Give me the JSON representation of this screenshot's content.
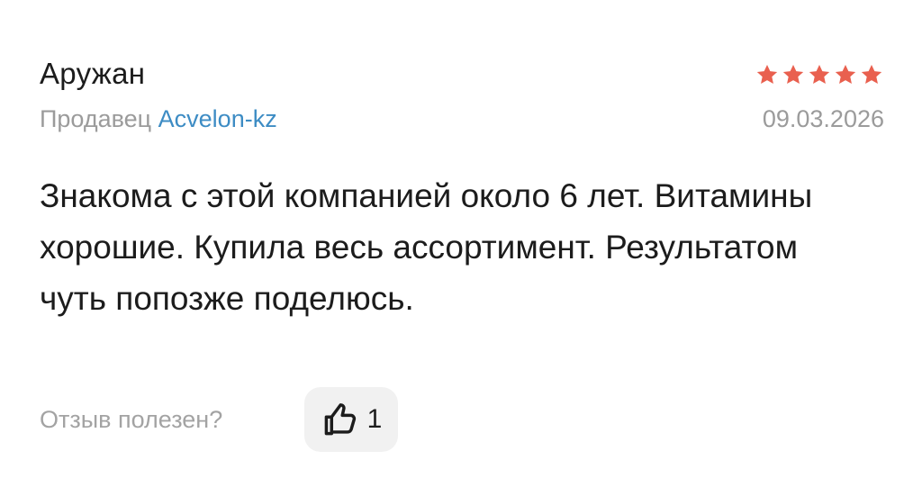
{
  "review": {
    "author": "Аружан",
    "rating": 5,
    "rating_max": 5,
    "star_color": "#e9604f",
    "seller_prefix": "Продавец",
    "seller_name": "Acvelon-kz",
    "seller_color": "#3d8cc4",
    "date": "09.03.2026",
    "text": "Знакома с этой компанией около 6 лет. Витамины хорошие. Купила весь ассортимент. Результатом чуть попозже поделюсь."
  },
  "helpful": {
    "label": "Отзыв полезен?",
    "icon": "thumbs-up-icon",
    "count": "1"
  }
}
